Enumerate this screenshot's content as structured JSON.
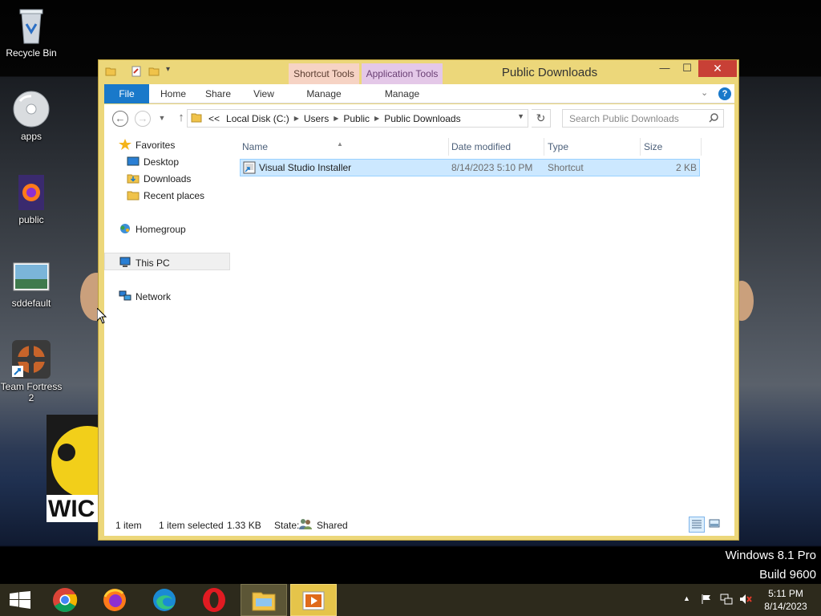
{
  "desktop": {
    "icons": [
      {
        "label": "Recycle Bin",
        "icon": "recycle-bin-icon"
      },
      {
        "label": "apps",
        "icon": "disc-drive-icon"
      },
      {
        "label": "public",
        "icon": "firefox-file-icon"
      },
      {
        "label": "sddefault",
        "icon": "image-file-icon"
      },
      {
        "label": "Team Fortress 2",
        "icon": "team-fortress-2-icon"
      }
    ],
    "watermark_line1": "Windows 8.1 Pro",
    "watermark_line2": "Build 9600",
    "partial_logo_text": "WIC"
  },
  "window": {
    "title": "Public Downloads",
    "contextual_tabs": {
      "shortcut_tools": "Shortcut Tools",
      "application_tools": "Application Tools"
    },
    "ribbon_tabs": [
      "File",
      "Home",
      "Share",
      "View",
      "Manage",
      "Manage"
    ],
    "breadcrumb": {
      "overflow": "<<",
      "items": [
        "Local Disk (C:)",
        "Users",
        "Public",
        "Public Downloads"
      ]
    },
    "search_placeholder": "Search Public Downloads",
    "nav_pane": {
      "favorites": "Favorites",
      "favorite_items": [
        "Desktop",
        "Downloads",
        "Recent places"
      ],
      "homegroup": "Homegroup",
      "this_pc": "This PC",
      "network": "Network"
    },
    "columns": {
      "name": "Name",
      "date_modified": "Date modified",
      "type": "Type",
      "size": "Size"
    },
    "files": [
      {
        "name": "Visual Studio Installer",
        "date_modified": "8/14/2023 5:10 PM",
        "type": "Shortcut",
        "size": "2 KB",
        "selected": true
      }
    ],
    "status": {
      "item_count": "1 item",
      "selected": "1 item selected",
      "selected_size": "1.33 KB",
      "state_label": "State:",
      "state_value": "Shared"
    }
  },
  "taskbar": {
    "apps": [
      "chrome-icon",
      "firefox-icon",
      "edge-icon",
      "opera-icon",
      "file-explorer-icon",
      "media-player-icon"
    ],
    "clock_time": "5:11 PM",
    "clock_date": "8/14/2023"
  },
  "colors": {
    "window_frame": "#ecd77a",
    "accent": "#1979ca",
    "close": "#c84036",
    "selection": "#cce8ff"
  }
}
